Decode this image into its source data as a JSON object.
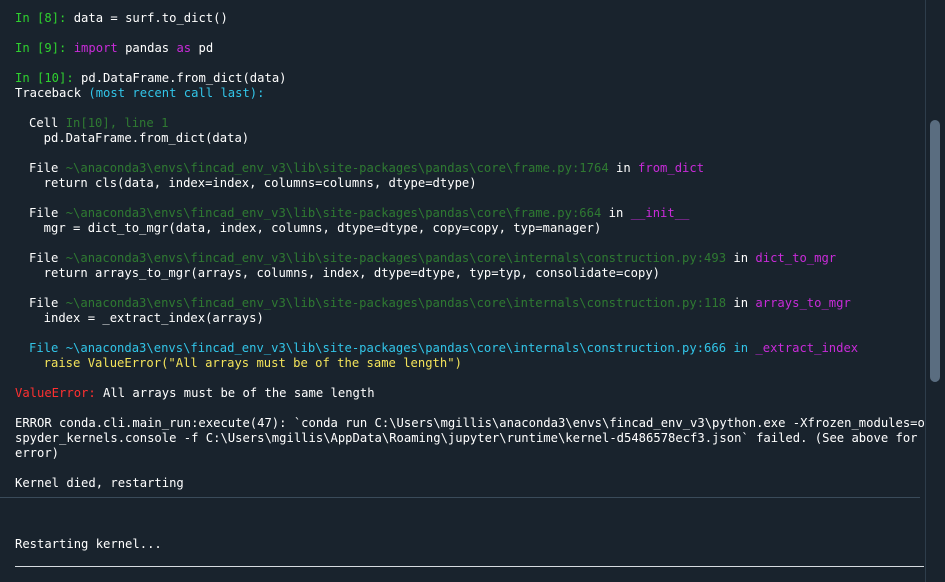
{
  "cells": {
    "c8": {
      "prompt": "In [8]:",
      "code": "data = surf.to_dict()"
    },
    "c9": {
      "prompt": "In [9]:",
      "kw1": "import",
      "mod": "pandas",
      "kw2": "as",
      "alias": "pd"
    },
    "c10": {
      "prompt": "In [10]:",
      "code": "pd.DataFrame.from_dict(data)"
    }
  },
  "traceback": {
    "header_a": "Traceback ",
    "header_b": "(most recent call last):",
    "cell_word": "Cell ",
    "cell_ref": "In[10], line 1",
    "cell_code": "  pd.DataFrame.from_dict(data)",
    "frames": [
      {
        "file": "File ",
        "path": "~\\anaconda3\\envs\\fincad_env_v3\\lib\\site-packages\\pandas\\core\\frame.py:1764",
        "in": " in ",
        "func": "from_dict",
        "code": "  return cls(data, index=index, columns=columns, dtype=dtype)"
      },
      {
        "file": "File ",
        "path": "~\\anaconda3\\envs\\fincad_env_v3\\lib\\site-packages\\pandas\\core\\frame.py:664",
        "in": " in ",
        "func": "__init__",
        "code": "  mgr = dict_to_mgr(data, index, columns, dtype=dtype, copy=copy, typ=manager)"
      },
      {
        "file": "File ",
        "path": "~\\anaconda3\\envs\\fincad_env_v3\\lib\\site-packages\\pandas\\core\\internals\\construction.py:493",
        "in": " in ",
        "func": "dict_to_mgr",
        "code": "  return arrays_to_mgr(arrays, columns, index, dtype=dtype, typ=typ, consolidate=copy)"
      },
      {
        "file": "File ",
        "path": "~\\anaconda3\\envs\\fincad_env_v3\\lib\\site-packages\\pandas\\core\\internals\\construction.py:118",
        "in": " in ",
        "func": "arrays_to_mgr",
        "code": "  index = _extract_index(arrays)"
      },
      {
        "file": "File ",
        "path": "~\\anaconda3\\envs\\fincad_env_v3\\lib\\site-packages\\pandas\\core\\internals\\construction.py:666",
        "in": " in ",
        "func": "_extract_index",
        "code": "  raise ValueError(\"All arrays must be of the same length\")"
      }
    ],
    "error_type": "ValueError:",
    "error_msg": " All arrays must be of the same length"
  },
  "conda_error": [
    "ERROR conda.cli.main_run:execute(47): `conda run C:\\Users\\mgillis\\anaconda3\\envs\\fincad_env_v3\\python.exe -Xfrozen_modules=off -m",
    "spyder_kernels.console -f C:\\Users\\mgillis\\AppData\\Roaming\\jupyter\\runtime\\kernel-d5486578ecf3.json` failed. (See above for",
    "error)"
  ],
  "kernel_died": "Kernel died, restarting",
  "restarting": "Restarting kernel...",
  "colors": {
    "background": "#19232d",
    "prompt": "#2fd12f",
    "keyword": "#c82bd8",
    "traceback_accent": "#32c5e8",
    "path": "#2f7a32",
    "error": "#ff3030",
    "highlight": "#f3e35a"
  }
}
